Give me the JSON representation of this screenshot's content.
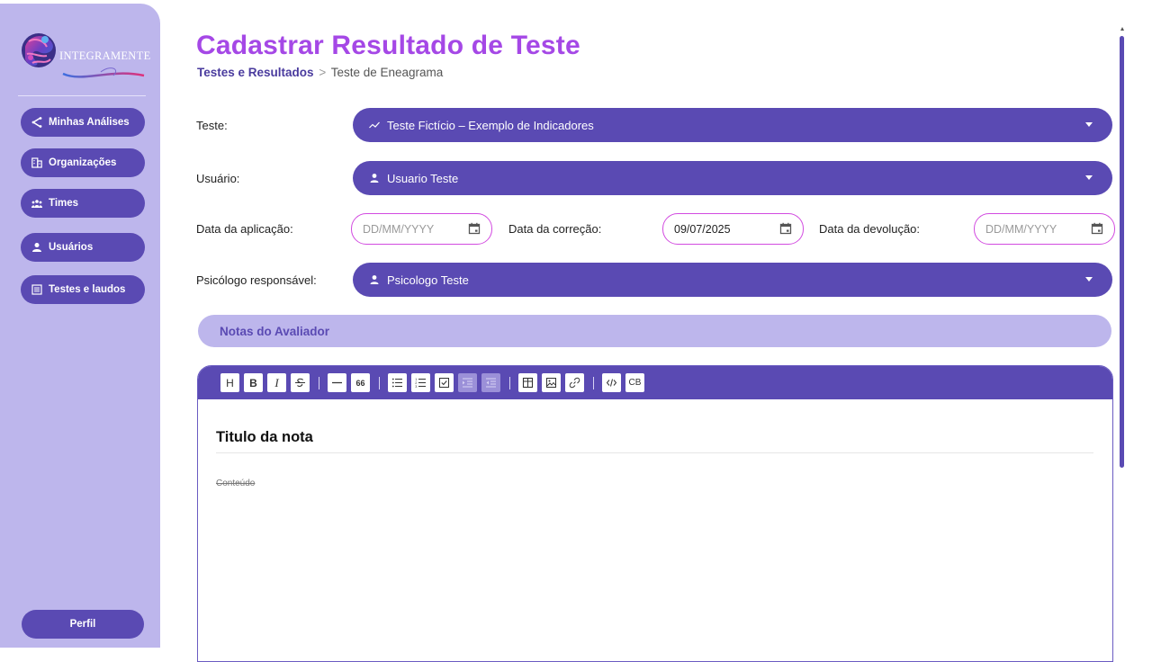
{
  "app": {
    "logo_text": "INTEGRAMENTE"
  },
  "sidebar": {
    "items": [
      {
        "label": "Minhas Análises",
        "icon": "share-icon"
      },
      {
        "label": "Organizações",
        "icon": "building-icon"
      },
      {
        "label": "Times",
        "icon": "team-icon"
      },
      {
        "label": "Usuários",
        "icon": "user-icon"
      },
      {
        "label": "Testes e laudos",
        "icon": "clipboard-icon"
      }
    ],
    "profile_label": "Perfil"
  },
  "header": {
    "title": "Cadastrar Resultado de Teste",
    "breadcrumb": {
      "parent": "Testes e Resultados",
      "separator": ">",
      "current": "Teste de Eneagrama"
    }
  },
  "form": {
    "test": {
      "label": "Teste:",
      "value": "Teste Fictício – Exemplo de Indicadores",
      "icon": "trend-icon"
    },
    "user": {
      "label": "Usuário:",
      "value": "Usuario Teste",
      "icon": "person-icon"
    },
    "application_date": {
      "label": "Data da aplicação:",
      "value": "",
      "placeholder": "DD/MM/YYYY"
    },
    "correction_date": {
      "label": "Data da correção:",
      "value": "09/07/2025",
      "placeholder": "DD/MM/YYYY"
    },
    "return_date": {
      "label": "Data da devolução:",
      "value": "",
      "placeholder": "DD/MM/YYYY"
    },
    "psychologist": {
      "label": "Psicólogo responsável:",
      "value": "Psicologo Teste",
      "icon": "person-icon"
    }
  },
  "notes": {
    "section_title": "Notas do Avaliador",
    "toolbar": {
      "heading": "H",
      "bold": "B",
      "italic": "I",
      "quote": "66",
      "code_block": "CB"
    },
    "note_title": "Titulo da nota",
    "note_content": "Conteúdo"
  },
  "colors": {
    "primary": "#5a4ab3",
    "sidebar_bg": "#bdb6ec",
    "title": "#a548e6",
    "date_border": "#d24be0"
  }
}
